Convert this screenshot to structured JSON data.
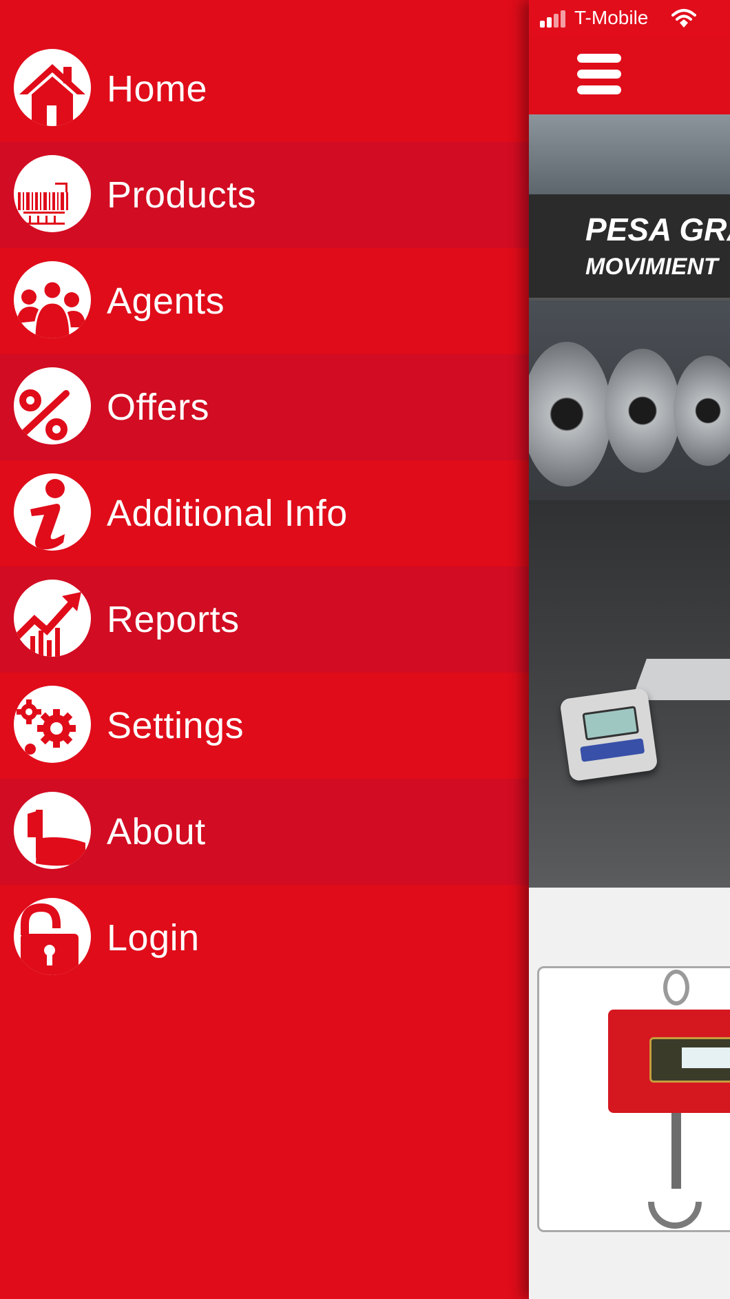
{
  "colors": {
    "drawer_bg": "#e00c1a",
    "drawer_alt_row": "#d20c22",
    "icon_bg": "#ffffff",
    "icon_fg": "#e00c1a",
    "label": "#ffffff"
  },
  "menu": {
    "items": [
      {
        "label": "Home",
        "icon": "home-icon"
      },
      {
        "label": "Products",
        "icon": "barcode-icon"
      },
      {
        "label": "Agents",
        "icon": "people-icon"
      },
      {
        "label": "Offers",
        "icon": "percent-icon"
      },
      {
        "label": "Additional Info",
        "icon": "info-icon"
      },
      {
        "label": "Reports",
        "icon": "trend-chart-icon"
      },
      {
        "label": "Settings",
        "icon": "gears-icon"
      },
      {
        "label": "About",
        "icon": "flag-icon"
      },
      {
        "label": "Login",
        "icon": "unlock-icon"
      }
    ]
  },
  "status_bar": {
    "carrier": "T-Mobile",
    "signal_icon": "signal-bars-icon",
    "wifi_icon": "wifi-icon"
  },
  "navbar": {
    "menu_icon": "hamburger-menu-icon"
  },
  "hero": {
    "banner_line_1": "PESA GRA",
    "banner_line_2": "MOVIMIENT"
  }
}
